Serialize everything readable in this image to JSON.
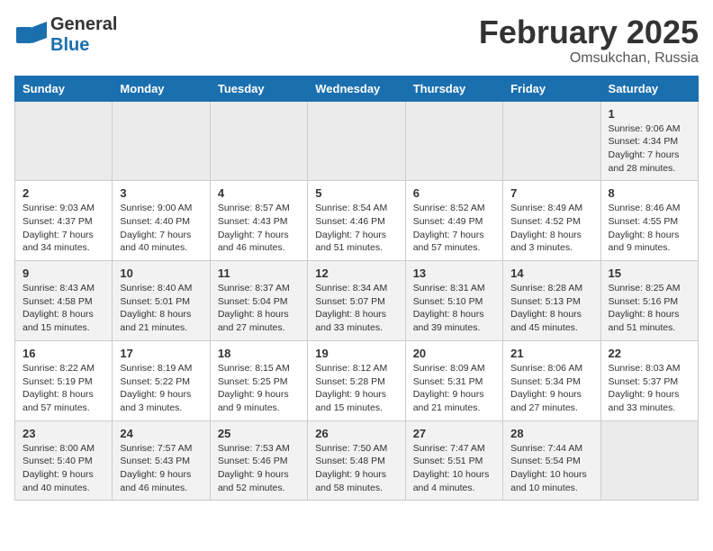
{
  "logo": {
    "general": "General",
    "blue": "Blue"
  },
  "header": {
    "title": "February 2025",
    "subtitle": "Omsukchan, Russia"
  },
  "weekdays": [
    "Sunday",
    "Monday",
    "Tuesday",
    "Wednesday",
    "Thursday",
    "Friday",
    "Saturday"
  ],
  "weeks": [
    [
      {
        "day": "",
        "empty": true
      },
      {
        "day": "",
        "empty": true
      },
      {
        "day": "",
        "empty": true
      },
      {
        "day": "",
        "empty": true
      },
      {
        "day": "",
        "empty": true
      },
      {
        "day": "",
        "empty": true
      },
      {
        "day": "1",
        "sunrise": "9:06 AM",
        "sunset": "4:34 PM",
        "daylight": "7 hours and 28 minutes."
      }
    ],
    [
      {
        "day": "2",
        "sunrise": "9:03 AM",
        "sunset": "4:37 PM",
        "daylight": "7 hours and 34 minutes."
      },
      {
        "day": "3",
        "sunrise": "9:00 AM",
        "sunset": "4:40 PM",
        "daylight": "7 hours and 40 minutes."
      },
      {
        "day": "4",
        "sunrise": "8:57 AM",
        "sunset": "4:43 PM",
        "daylight": "7 hours and 46 minutes."
      },
      {
        "day": "5",
        "sunrise": "8:54 AM",
        "sunset": "4:46 PM",
        "daylight": "7 hours and 51 minutes."
      },
      {
        "day": "6",
        "sunrise": "8:52 AM",
        "sunset": "4:49 PM",
        "daylight": "7 hours and 57 minutes."
      },
      {
        "day": "7",
        "sunrise": "8:49 AM",
        "sunset": "4:52 PM",
        "daylight": "8 hours and 3 minutes."
      },
      {
        "day": "8",
        "sunrise": "8:46 AM",
        "sunset": "4:55 PM",
        "daylight": "8 hours and 9 minutes."
      }
    ],
    [
      {
        "day": "9",
        "sunrise": "8:43 AM",
        "sunset": "4:58 PM",
        "daylight": "8 hours and 15 minutes."
      },
      {
        "day": "10",
        "sunrise": "8:40 AM",
        "sunset": "5:01 PM",
        "daylight": "8 hours and 21 minutes."
      },
      {
        "day": "11",
        "sunrise": "8:37 AM",
        "sunset": "5:04 PM",
        "daylight": "8 hours and 27 minutes."
      },
      {
        "day": "12",
        "sunrise": "8:34 AM",
        "sunset": "5:07 PM",
        "daylight": "8 hours and 33 minutes."
      },
      {
        "day": "13",
        "sunrise": "8:31 AM",
        "sunset": "5:10 PM",
        "daylight": "8 hours and 39 minutes."
      },
      {
        "day": "14",
        "sunrise": "8:28 AM",
        "sunset": "5:13 PM",
        "daylight": "8 hours and 45 minutes."
      },
      {
        "day": "15",
        "sunrise": "8:25 AM",
        "sunset": "5:16 PM",
        "daylight": "8 hours and 51 minutes."
      }
    ],
    [
      {
        "day": "16",
        "sunrise": "8:22 AM",
        "sunset": "5:19 PM",
        "daylight": "8 hours and 57 minutes."
      },
      {
        "day": "17",
        "sunrise": "8:19 AM",
        "sunset": "5:22 PM",
        "daylight": "9 hours and 3 minutes."
      },
      {
        "day": "18",
        "sunrise": "8:15 AM",
        "sunset": "5:25 PM",
        "daylight": "9 hours and 9 minutes."
      },
      {
        "day": "19",
        "sunrise": "8:12 AM",
        "sunset": "5:28 PM",
        "daylight": "9 hours and 15 minutes."
      },
      {
        "day": "20",
        "sunrise": "8:09 AM",
        "sunset": "5:31 PM",
        "daylight": "9 hours and 21 minutes."
      },
      {
        "day": "21",
        "sunrise": "8:06 AM",
        "sunset": "5:34 PM",
        "daylight": "9 hours and 27 minutes."
      },
      {
        "day": "22",
        "sunrise": "8:03 AM",
        "sunset": "5:37 PM",
        "daylight": "9 hours and 33 minutes."
      }
    ],
    [
      {
        "day": "23",
        "sunrise": "8:00 AM",
        "sunset": "5:40 PM",
        "daylight": "9 hours and 40 minutes."
      },
      {
        "day": "24",
        "sunrise": "7:57 AM",
        "sunset": "5:43 PM",
        "daylight": "9 hours and 46 minutes."
      },
      {
        "day": "25",
        "sunrise": "7:53 AM",
        "sunset": "5:46 PM",
        "daylight": "9 hours and 52 minutes."
      },
      {
        "day": "26",
        "sunrise": "7:50 AM",
        "sunset": "5:48 PM",
        "daylight": "9 hours and 58 minutes."
      },
      {
        "day": "27",
        "sunrise": "7:47 AM",
        "sunset": "5:51 PM",
        "daylight": "10 hours and 4 minutes."
      },
      {
        "day": "28",
        "sunrise": "7:44 AM",
        "sunset": "5:54 PM",
        "daylight": "10 hours and 10 minutes."
      },
      {
        "day": "",
        "empty": true
      }
    ]
  ]
}
